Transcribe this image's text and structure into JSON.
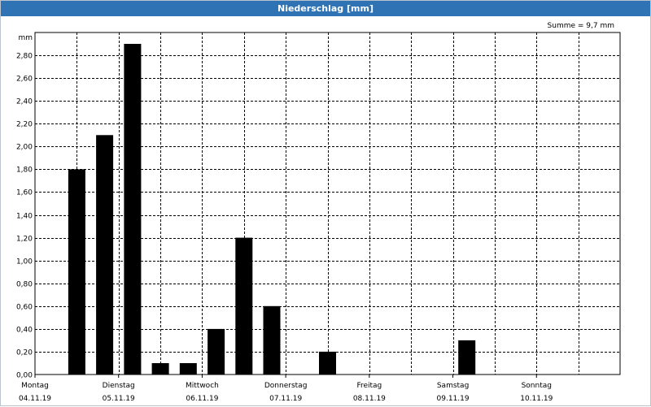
{
  "title": "Niederschlag [mm]",
  "summary": "Summe = 9,7 mm",
  "chart_data": {
    "type": "bar",
    "title": "Niederschlag [mm]",
    "ylabel": "mm",
    "ylim": [
      0,
      3.0
    ],
    "yticks": [
      "0,00",
      "0,20",
      "0,40",
      "0,60",
      "0,80",
      "1,00",
      "1,20",
      "1,40",
      "1,60",
      "1,80",
      "2,00",
      "2,20",
      "2,40",
      "2,60",
      "2,80"
    ],
    "day_labels": [
      {
        "day": "Montag",
        "date": "04.11.19"
      },
      {
        "day": "Dienstag",
        "date": "05.11.19"
      },
      {
        "day": "Mittwoch",
        "date": "06.11.19"
      },
      {
        "day": "Donnerstag",
        "date": "07.11.19"
      },
      {
        "day": "Freitag",
        "date": "08.11.19"
      },
      {
        "day": "Samstag",
        "date": "09.11.19"
      },
      {
        "day": "Sonntag",
        "date": "10.11.19"
      }
    ],
    "x_unit": "days from 04.11.19 00:00",
    "bars": [
      {
        "x": 0.5,
        "value": 1.8
      },
      {
        "x": 0.833,
        "value": 2.1
      },
      {
        "x": 1.167,
        "value": 2.9
      },
      {
        "x": 1.5,
        "value": 0.1
      },
      {
        "x": 1.833,
        "value": 0.1
      },
      {
        "x": 2.167,
        "value": 0.4
      },
      {
        "x": 2.5,
        "value": 1.2
      },
      {
        "x": 2.833,
        "value": 0.6
      },
      {
        "x": 3.5,
        "value": 0.2
      },
      {
        "x": 5.167,
        "value": 0.3
      }
    ],
    "grid": true,
    "bar_color": "#000000"
  },
  "colors": {
    "titlebar": "#2f73b5",
    "bars": "#000000",
    "grid": "#000000"
  }
}
